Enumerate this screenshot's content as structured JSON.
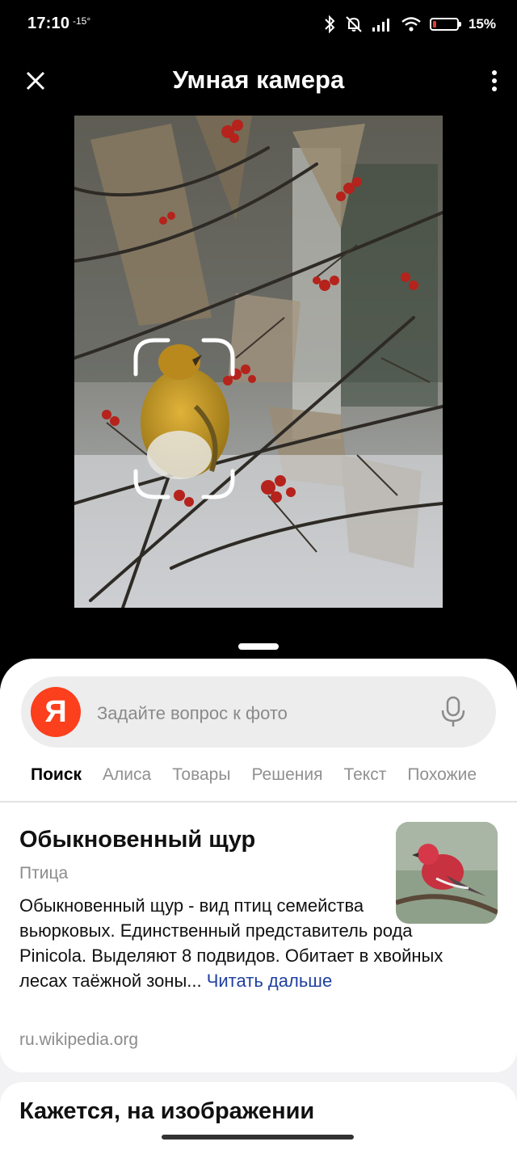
{
  "status": {
    "time": "17:10",
    "temperature": "-15°",
    "battery_percent": "15%",
    "battery_level": 0.15,
    "icons": [
      "bluetooth-icon",
      "mute-icon",
      "signal-icon",
      "wifi-icon",
      "battery-icon"
    ]
  },
  "header": {
    "title": "Умная камера",
    "close_icon": "close-icon",
    "menu_icon": "more-vert-icon"
  },
  "search": {
    "logo": "Я",
    "placeholder": "Задайте вопрос к фото",
    "mic_icon": "microphone-icon"
  },
  "tabs": [
    {
      "label": "Поиск",
      "active": true
    },
    {
      "label": "Алиса",
      "active": false
    },
    {
      "label": "Товары",
      "active": false
    },
    {
      "label": "Решения",
      "active": false
    },
    {
      "label": "Текст",
      "active": false
    },
    {
      "label": "Похожие",
      "active": false
    }
  ],
  "result": {
    "name": "Обыкновенный щур",
    "type": "Птица",
    "description": "Обыкновенный щур - вид птиц семейства вьюрковых. Единственный представитель рода Pinicola. Выделяют 8 подвидов. Обитает в хвойных лесах таёжной зоны...",
    "read_more": "Читать дальше",
    "source": "ru.wikipedia.org"
  },
  "section2": {
    "heading": "Кажется, на изображении"
  },
  "colors": {
    "yandex_red": "#fc3f1d",
    "link_blue": "#1f3f9e",
    "battery_low": "#e53935"
  }
}
